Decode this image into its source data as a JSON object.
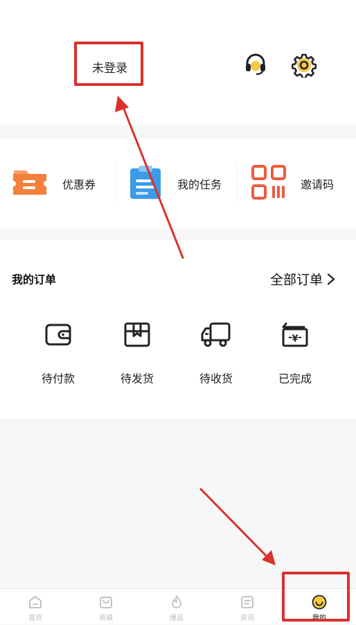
{
  "header": {
    "login_status": "未登录"
  },
  "icons": {
    "support": "headset-icon",
    "settings": "gear-icon"
  },
  "quick_actions": [
    {
      "label": "优惠券",
      "icon": "coupon-icon"
    },
    {
      "label": "我的任务",
      "icon": "clipboard-icon"
    },
    {
      "label": "邀请码",
      "icon": "qr-code-icon"
    }
  ],
  "orders": {
    "title": "我的订单",
    "all_label": "全部订单",
    "statuses": [
      {
        "label": "待付款",
        "icon": "wallet-icon"
      },
      {
        "label": "待发货",
        "icon": "box-icon"
      },
      {
        "label": "待收货",
        "icon": "truck-icon"
      },
      {
        "label": "已完成",
        "icon": "receipt-icon"
      }
    ]
  },
  "tabbar": {
    "items": [
      {
        "label": "首页",
        "icon": "home-icon"
      },
      {
        "label": "商城",
        "icon": "shopping-bag-icon"
      },
      {
        "label": "爆品",
        "icon": "flame-icon"
      },
      {
        "label": "资讯",
        "icon": "news-icon"
      },
      {
        "label": "我的",
        "icon": "smiley-icon"
      }
    ],
    "active_index": 4
  },
  "colors": {
    "annotation_red": "#d9312c",
    "accent_yellow": "#f6c945",
    "coupon_orange": "#f47f3b",
    "task_blue": "#3a9be8",
    "qr_red": "#f05a3d"
  }
}
